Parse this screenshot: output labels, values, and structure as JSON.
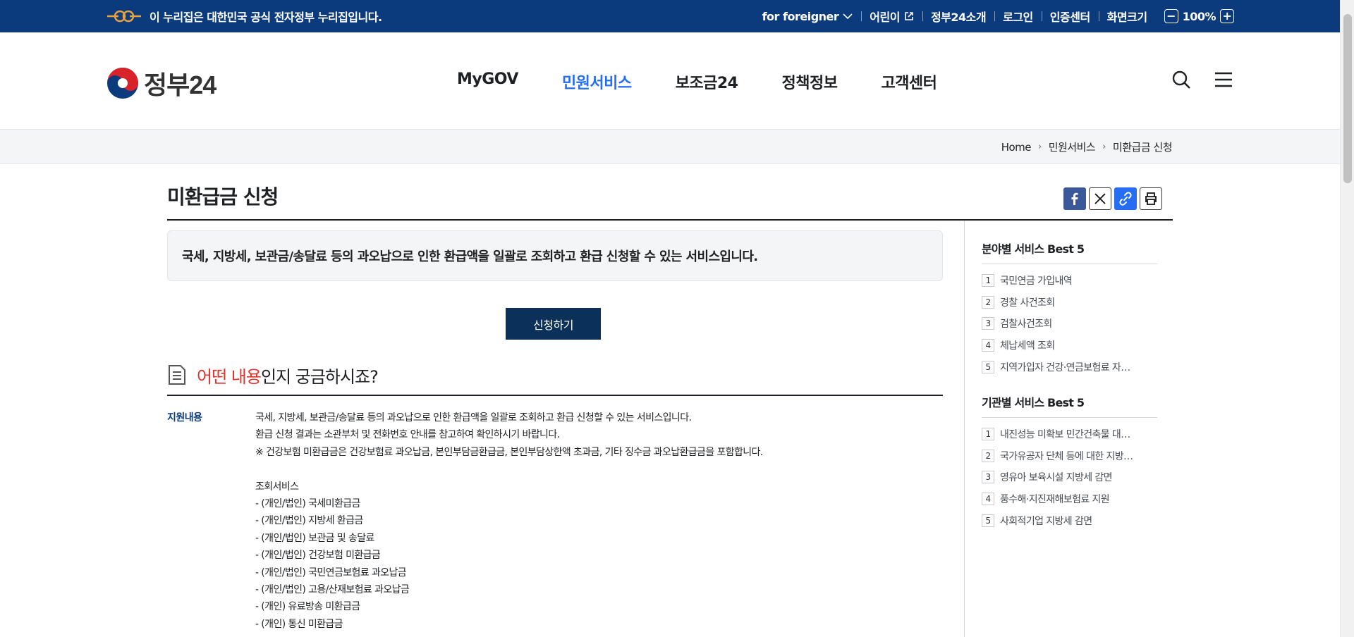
{
  "banner": {
    "notice": "이 누리집은 대한민국 공식 전자정부 누리집입니다.",
    "links": [
      "for foreigner",
      "어린이",
      "정부24소개",
      "로그인",
      "인증센터",
      "화면크기"
    ],
    "zoom_value": "100%",
    "zoom_minus": "−",
    "zoom_plus": "+"
  },
  "header": {
    "logo_text": "정부24",
    "menus": [
      "MyGOV",
      "민원서비스",
      "보조금24",
      "정책정보",
      "고객센터"
    ],
    "active_menu": "민원서비스"
  },
  "breadcrumb": [
    "Home",
    "민원서비스",
    "미환급금 신청"
  ],
  "page": {
    "title": "미환급금 신청",
    "summary": "국세, 지방세, 보관금/송달료 등의 과오납으로 인한 환급액을 일괄로 조회하고 환급 신청할 수 있는 서비스입니다.",
    "apply_label": "신청하기",
    "section_heading_red": "어떤 내용",
    "section_heading_rest": "인지 궁금하시죠?",
    "support_label": "지원내용",
    "support_lines": [
      "국세, 지방세, 보관금/송달료 등의 과오납으로 인한 환급액을 일괄로 조회하고 환급 신청할 수 있는 서비스입니다.",
      "환급 신청 결과는 소관부처 및 전화번호 안내를 참고하여 확인하시기 바랍니다.",
      "※ 건강보험 미환급금은 건강보험료 과오납금, 본인부담금환급금, 본인부담상한액 초과금, 기타 징수금 과오납환급금을 포함합니다.",
      "",
      "조회서비스",
      " - (개인/법인) 국세미환급금",
      " - (개인/법인) 지방세 환급금",
      " - (개인/법인) 보관금 및 송달료",
      " - (개인/법인) 건강보험 미환급금",
      " - (개인/법인) 국민연금보험료 과오납금",
      " - (개인/법인) 고용/산재보험료 과오납금",
      " - (개인) 유료방송 미환급금",
      " - (개인) 통신 미환급금"
    ]
  },
  "sidebar": {
    "best_field_title": "분야별 서비스 Best 5",
    "best_field": [
      "국민연금 가입내역",
      "경찰 사건조회",
      "검찰사건조회",
      "체납세액 조회",
      "지역가입자 건강·연금보험료 자…"
    ],
    "best_org_title": "기관별 서비스 Best 5",
    "best_org": [
      "내진성능 미확보 민간건축물 대…",
      "국가유공자 단체 등에 대한 지방…",
      "영유아 보육시설 지방세 감면",
      "풍수해·지진재해보험료 지원",
      "사회적기업 지방세 감면"
    ]
  },
  "colors": {
    "banner_bg": "#0b3b7c",
    "active_menu": "#256ef4",
    "apply_button": "#0b3059",
    "highlight_red": "#e5312b"
  }
}
